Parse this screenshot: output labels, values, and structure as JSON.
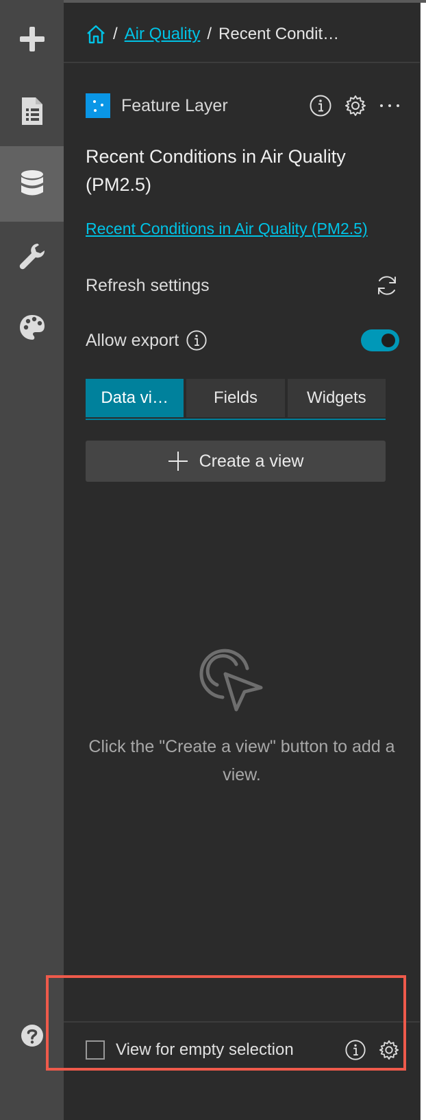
{
  "breadcrumb": {
    "home_icon": "home-icon",
    "item1": "Air Quality",
    "item2": "Recent Condit…",
    "separator": "/"
  },
  "sidebar": {
    "items": [
      {
        "name": "add",
        "icon": "plus-icon"
      },
      {
        "name": "page",
        "icon": "document-icon"
      },
      {
        "name": "data",
        "icon": "database-icon",
        "active": true
      },
      {
        "name": "tools",
        "icon": "wrench-icon"
      },
      {
        "name": "theme",
        "icon": "palette-icon"
      }
    ],
    "help_icon": "help-icon"
  },
  "layer": {
    "type_label": "Feature Layer",
    "title": "Recent Conditions in Air Quality (PM2.5)",
    "link": "Recent Conditions in Air Quality (PM2.5)"
  },
  "settings": {
    "refresh_label": "Refresh settings",
    "export_label": "Allow export",
    "export_enabled": true
  },
  "tabs": [
    {
      "label": "Data vi…",
      "active": true
    },
    {
      "label": "Fields",
      "active": false
    },
    {
      "label": "Widgets",
      "active": false
    }
  ],
  "create_view": {
    "label": "Create a view"
  },
  "empty_state": {
    "message": "Click the \"Create a view\" button to add a view."
  },
  "footer": {
    "checkbox_label": "View for empty selection",
    "checked": false
  },
  "colors": {
    "accent": "#00819c",
    "link": "#00c3e6",
    "highlight": "#ee5a4b",
    "layer_icon": "#0a96e6"
  }
}
